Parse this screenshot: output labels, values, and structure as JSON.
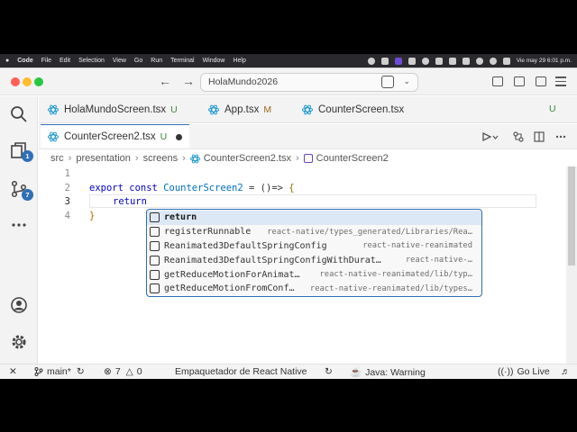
{
  "menubar": {
    "app_name": "Code",
    "items": [
      "File",
      "Edit",
      "Selection",
      "View",
      "Go",
      "Run",
      "Terminal",
      "Window",
      "Help"
    ],
    "clock": "Vie may 29  6:01 p.m."
  },
  "titlebar": {
    "search_text": "HolaMundo2026"
  },
  "activity": {
    "explorer_badge": "1",
    "scm_badge": "7"
  },
  "tabs": [
    {
      "label": "HolaMundoScreen.tsx",
      "mark": "U"
    },
    {
      "label": "App.tsx",
      "mark": "M"
    },
    {
      "label": "CounterScreen.tsx",
      "mark": "U"
    },
    {
      "label": "CounterScreen2.tsx",
      "mark": "U"
    }
  ],
  "breadcrumb": {
    "parts": [
      "src",
      "presentation",
      "screens",
      "CounterScreen2.tsx",
      "CounterScreen2"
    ]
  },
  "editor": {
    "line_numbers": [
      "1",
      "2",
      "3",
      "4"
    ],
    "line2": {
      "kw1": "export",
      "kw2": "const",
      "name": "CounterScreen2",
      "op": " = ()=> ",
      "brace": "{"
    },
    "line3": {
      "kw": "return"
    },
    "line4": {
      "brace": "}"
    }
  },
  "suggestions": [
    {
      "label": "return",
      "detail": ""
    },
    {
      "label": "registerRunnable",
      "detail": "react-native/types_generated/Libraries/Rea…"
    },
    {
      "label": "Reanimated3DefaultSpringConfig",
      "detail": "react-native-reanimated"
    },
    {
      "label": "Reanimated3DefaultSpringConfigWithDurat…",
      "detail": "react-native-…"
    },
    {
      "label": "getReduceMotionForAnimat…",
      "detail": "react-native-reanimated/lib/typ…"
    },
    {
      "label": "getReduceMotionFromConf…",
      "detail": "react-native-reanimated/lib/types…"
    }
  ],
  "statusbar": {
    "branch": "main*",
    "errors": "7",
    "warnings": "0",
    "packager": "Empaquetador de React Native",
    "java": "Java: Warning",
    "golive": "Go Live"
  },
  "colors": {
    "accent": "#2f6fb6",
    "untracked": "#388a34",
    "modified": "#9a6b1d",
    "keyword": "#0000cc"
  }
}
